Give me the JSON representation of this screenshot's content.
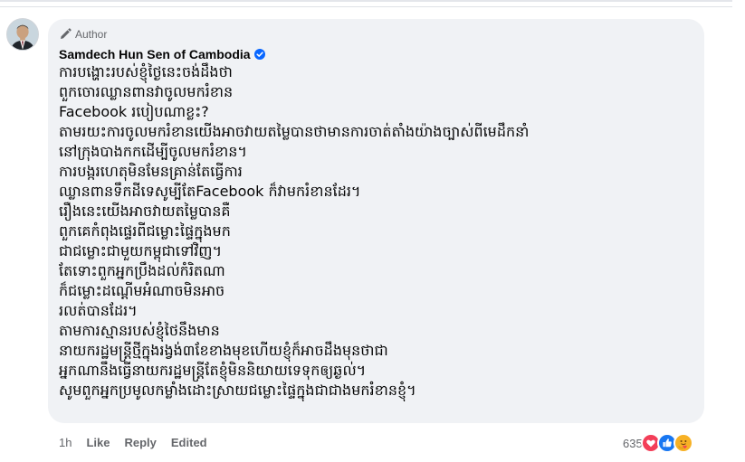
{
  "author_badge": {
    "label": "Author",
    "icon": "pencil-icon"
  },
  "comment": {
    "author_name": "Samdech Hun Sen of Cambodia",
    "verified_icon": "verified-badge-icon",
    "text": "ការបង្ហោះរបស់ខ្ញុំថ្ងៃនេះចង់ដឹងថា\nពួកចោរឈ្លានពានវាចូលមករំខាន\nFacebook របៀបណាខ្លះ?\nតាមរយះការចូលមករំខានយើងអាចវាយតម្លៃបានថាមានការចាត់តាំងយ៉ាងច្បាស់ពីមេដឹកនាំ\nនៅក្រុងបាងកកដើម្បីចូលមករំខាន។\nការបង្ករហេតុមិនមែនគ្រាន់តែធ្វើការ\nឈ្លានពានទឹកដីទេសូម្បីតែFacebook ក៏វាមករំខានដែរ។\nរឿងនេះយើងអាចវាយតម្លៃបានគឺ\nពួកគេកំពុងផ្ទេរពីជម្លោះផ្ទៃក្នុងមក\nជាជម្លោះជាមួយកម្ពុជាទៅវិញ។\nតែទោះពួកអ្នកប្រឹងដល់កំរិតណា\nក៏ជម្លោះដណ្ដើមអំណាចមិនអាច\nរលត់បានដែរ។\nតាមការស្មានរបស់ខ្ញុំថៃនឹងមាន\nនាយករដ្ឋមន្ត្រីថ្មីក្នុងរង្វង់៣ខែខាងមុខហើយខ្ញុំក៏អាចដឹងមុនថាជា\nអ្នកណានឹងធ្វើនាយករដ្ឋមន្ត្រីតែខ្ញុំមិននិយាយទេទុកឲ្យឆ្ងល់។\nសូមពួកអ្នកប្រមូលកម្លាំងដោះស្រាយជម្លោះផ្ទៃក្នុងជាជាងមករំខានខ្ញុំ។"
  },
  "actions": {
    "time": "1h",
    "like": "Like",
    "reply": "Reply",
    "edited": "Edited"
  },
  "reactions": {
    "count": "635",
    "icons": [
      "heart-icon",
      "like-icon",
      "care-icon"
    ]
  },
  "colors": {
    "bubble_bg": "#f0f2f5",
    "secondary_text": "#65676b",
    "verified_blue": "#0866ff",
    "like_blue": "#1877f2",
    "heart_red": "#f33e58",
    "care_yellow": "#f7b125"
  }
}
